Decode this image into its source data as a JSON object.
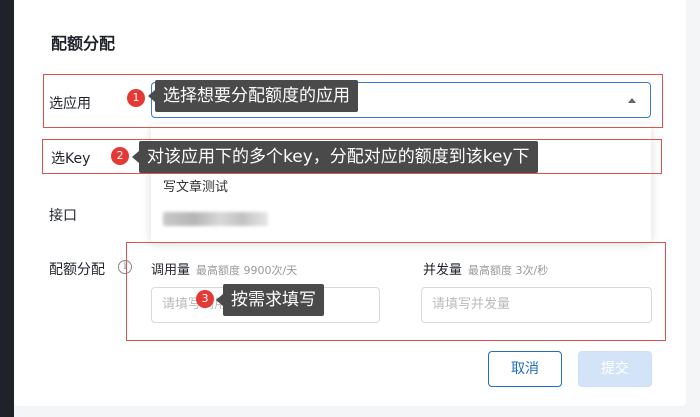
{
  "dialog": {
    "title": "配额分配"
  },
  "rows": {
    "app_label": "选应用",
    "key_label": "选Key",
    "api_label": "接口",
    "quota_label": "配额分配"
  },
  "app_select": {
    "callout": "选择想要分配额度的应用",
    "badge": "1"
  },
  "key_select": {
    "callout": "对该应用下的多个key，分配对应的额度到该key下",
    "badge": "2"
  },
  "dropdown": {
    "items": [
      "写文章测试"
    ]
  },
  "quota": {
    "calls_label": "调用量",
    "calls_hint": "最高额度 9900次/天",
    "calls_placeholder": "请填写调用量",
    "concurrency_label": "并发量",
    "concurrency_hint": "最高额度 3次/秒",
    "concurrency_placeholder": "请填写并发量",
    "callout": "按需求填写",
    "badge": "3"
  },
  "buttons": {
    "cancel": "取消",
    "submit": "提交"
  },
  "colors": {
    "accent": "#1f6fc5",
    "annotation_red": "#d9534f",
    "callout_bg": "#4a4a4a"
  }
}
